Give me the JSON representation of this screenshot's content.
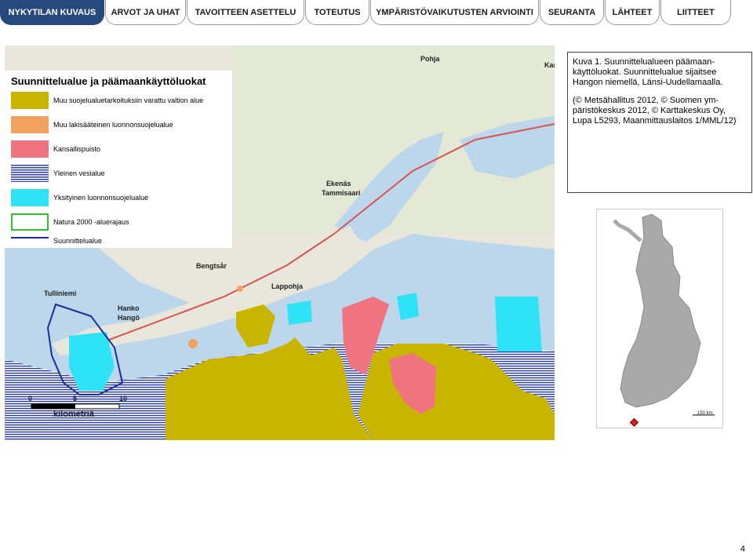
{
  "nav": {
    "tabs": [
      {
        "label": "NYKYTILAN KUVAUS",
        "active": true
      },
      {
        "label": "ARVOT JA UHAT",
        "active": false
      },
      {
        "label": "TAVOITTEEN ASETTELU",
        "active": false
      },
      {
        "label": "TOTEUTUS",
        "active": false
      },
      {
        "label": "YMPÄRISTÖVAIKUTUSTEN ARVIOINTI",
        "active": false
      },
      {
        "label": "SEURANTA",
        "active": false
      },
      {
        "label": "LÄHTEET",
        "active": false
      },
      {
        "label": "LIITTEET",
        "active": false
      }
    ]
  },
  "legend": {
    "title": "Suunnittelualue ja päämaankäyttöluokat",
    "items": [
      {
        "label": "Muu suojelualuetarkoituksiin varattu valtion alue",
        "color": "#c9b400"
      },
      {
        "label": "Muu lakisääteinen luonnonsuojelualue",
        "color": "#f2a15f"
      },
      {
        "label": "Kansallispuisto",
        "color": "#ef7480"
      },
      {
        "label": "Yleinen vesialue",
        "color": "#2d3fb0"
      },
      {
        "label": "Yksityinen luonnonsuojelualue",
        "color": "#2fe3f7"
      },
      {
        "label": "Natura 2000 -aluerajaus",
        "color": "#33bb33"
      },
      {
        "label": "Suunnittelualue",
        "color": "#1c2c9c"
      }
    ]
  },
  "map": {
    "places": {
      "bengtsar": "Bengtsår",
      "tulliniemi": "Tulliniemi",
      "hanko": "Hanko",
      "hango": "Hangö",
      "ekenas": "Ekenäs",
      "tammisaari": "Tammisaari",
      "lappohja": "Lappohja",
      "pohja": "Pohja",
      "karis": "Karis"
    },
    "scale": {
      "tick0": "0",
      "tick5": "5",
      "tick10": "10",
      "unit": "kilometriä"
    }
  },
  "caption": {
    "line1": "Kuva 1. Suunnittelualueen päämaan-käyttöluokat. Suunnittelualue sijaitsee Hangon niemellä, Länsi-Uudellamaalla.",
    "line2": "(© Metsähallitus 2012, © Suomen ym-päristökeskus 2012, © Karttakeskus Oy, Lupa L5293, Maanmittauslaitos 1/MML/12)"
  },
  "inset": {
    "scale_label": "150 km"
  },
  "page_number": "4"
}
